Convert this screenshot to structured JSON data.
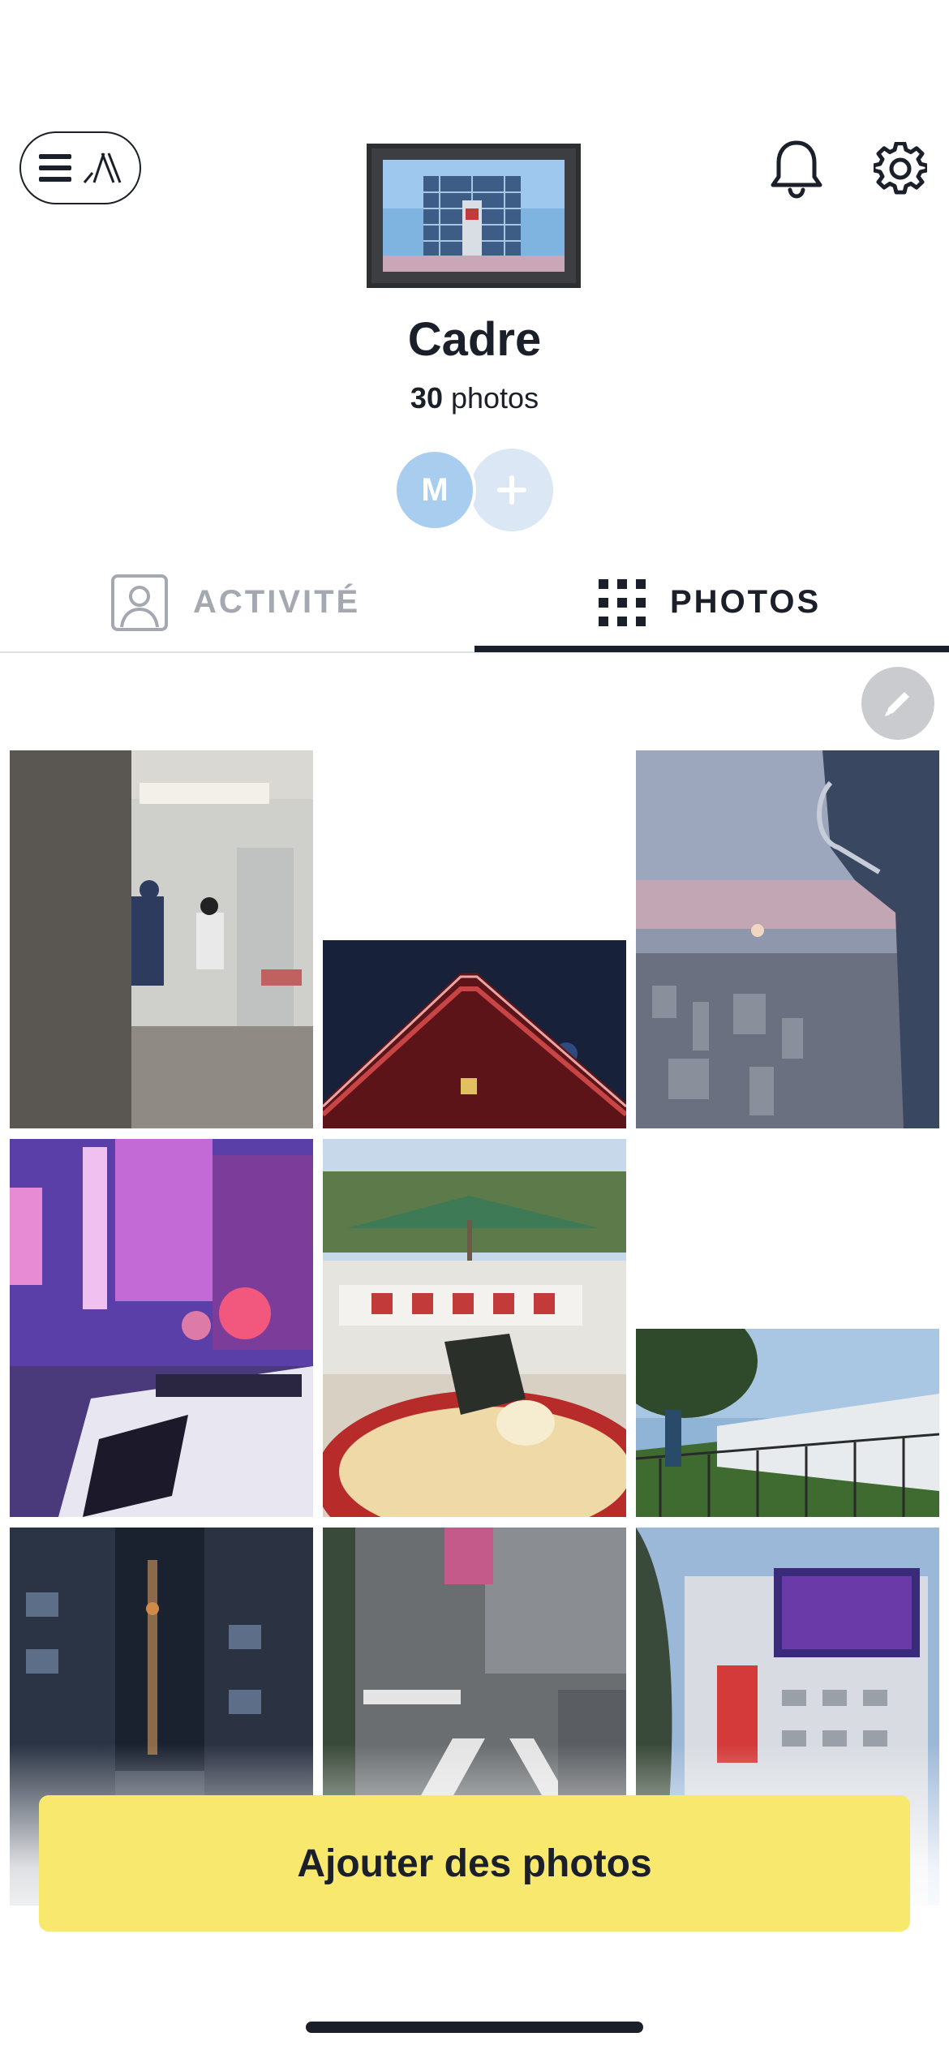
{
  "header": {
    "menu_icon": "hamburger-logo-icon",
    "bell_icon": "bell-icon",
    "settings_icon": "gear-icon"
  },
  "frame": {
    "title": "Cadre",
    "photo_count": "30",
    "photo_unit": "photos"
  },
  "members": {
    "avatar_initial": "M",
    "add_icon": "plus-icon"
  },
  "tabs": [
    {
      "label": "ACTIVITÉ",
      "icon": "person-icon",
      "active": false
    },
    {
      "label": "PHOTOS",
      "icon": "grid-icon",
      "active": true
    }
  ],
  "edit_icon": "pencil-icon",
  "photos": [
    {
      "subject": "subway-station-police"
    },
    {
      "subject": "temple-roof-night"
    },
    {
      "subject": "city-skyline-sunset"
    },
    {
      "subject": "neon-street-police-car"
    },
    {
      "subject": "ramen-bowl-shop"
    },
    {
      "subject": "white-house-fence"
    },
    {
      "subject": "alley-tower-night"
    },
    {
      "subject": "shibuya-crossing"
    },
    {
      "subject": "building-billboards"
    }
  ],
  "cta": {
    "label": "Ajouter des photos"
  },
  "colors": {
    "accent": "#f8e96e",
    "text": "#1b1f2a",
    "avatar": "#a9cdef"
  }
}
